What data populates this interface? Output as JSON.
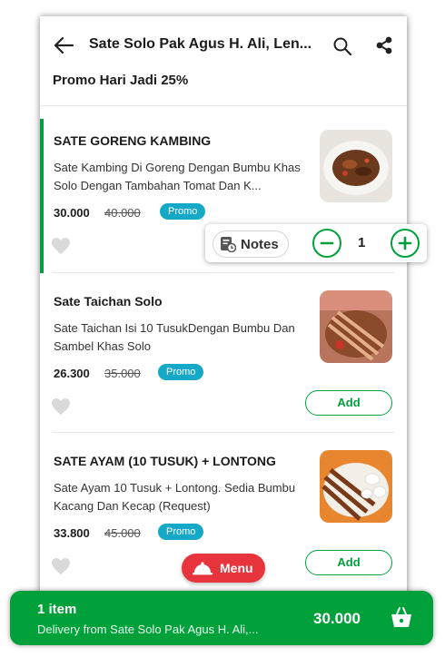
{
  "header": {
    "title": "Sate Solo Pak Agus H. Ali, Len...",
    "icons": [
      "back-arrow-icon",
      "search-icon",
      "share-icon"
    ]
  },
  "promo_section": {
    "title": "Promo Hari Jadi 25%"
  },
  "items": [
    {
      "name": "SATE GORENG KAMBING",
      "description": "Sate Kambing Di Goreng Dengan Bumbu Khas Solo Dengan Tambahan Tomat Dan K...",
      "price": "30.000",
      "original_price": "40.000",
      "badge": "Promo",
      "in_cart": true
    },
    {
      "name": "Sate Taichan Solo",
      "description": "Sate Taichan Isi 10 TusukDengan Bumbu Dan Sambel Khas Solo",
      "price": "26.300",
      "original_price": "35.000",
      "badge": "Promo",
      "add_label": "Add"
    },
    {
      "name": "SATE AYAM (10 TUSUK) + LONTONG",
      "description": "Sate Ayam 10 Tusuk + Lontong. Sedia Bumbu Kacang Dan Kecap (Request)",
      "price": "33.800",
      "original_price": "45.000",
      "badge": "Promo",
      "add_label": "Add"
    }
  ],
  "item_controls": {
    "notes_label": "Notes",
    "quantity": "1"
  },
  "menu_button": {
    "label": "Menu"
  },
  "cart_bar": {
    "count": "1 item",
    "subtitle": "Delivery from Sate Solo Pak Agus H. Ali,...",
    "total": "30.000"
  },
  "colors": {
    "primary_green": "#00a13b",
    "promo_badge": "#16a9c7",
    "menu_red": "#e8343c"
  }
}
